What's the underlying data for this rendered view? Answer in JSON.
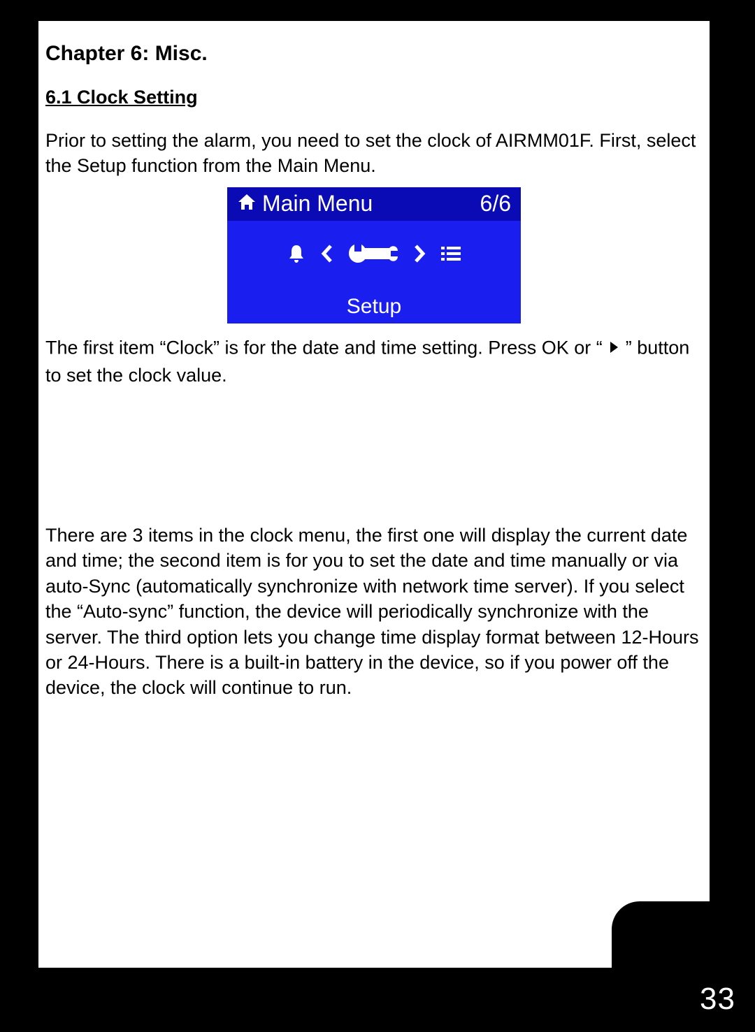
{
  "chapter_title": "Chapter 6: Misc.",
  "section_title": "6.1 Clock Setting",
  "para1": "Prior to setting the alarm, you need to set the clock of AIRMM01F. First, select the Setup function from the Main Menu.",
  "screen": {
    "header_title": "Main Menu",
    "header_count": "6/6",
    "footer_label": "Setup"
  },
  "para2_a": "The first item “Clock” is for the date and time setting. Press OK or  “ ",
  "para2_b": " ” button to set the clock value.",
  "para3": "There are 3 items in the clock menu, the first one will display the current date and time; the second item is for you to set the date and time manually or via auto-Sync (automatically synchronize with network time server). If you select the “Auto-sync” function, the device will periodically synchronize with the server. The third option lets you change time display format between 12-Hours or 24-Hours. There is a built-in battery in the device, so if you power off the device, the clock will continue to run.",
  "page_number": "33"
}
